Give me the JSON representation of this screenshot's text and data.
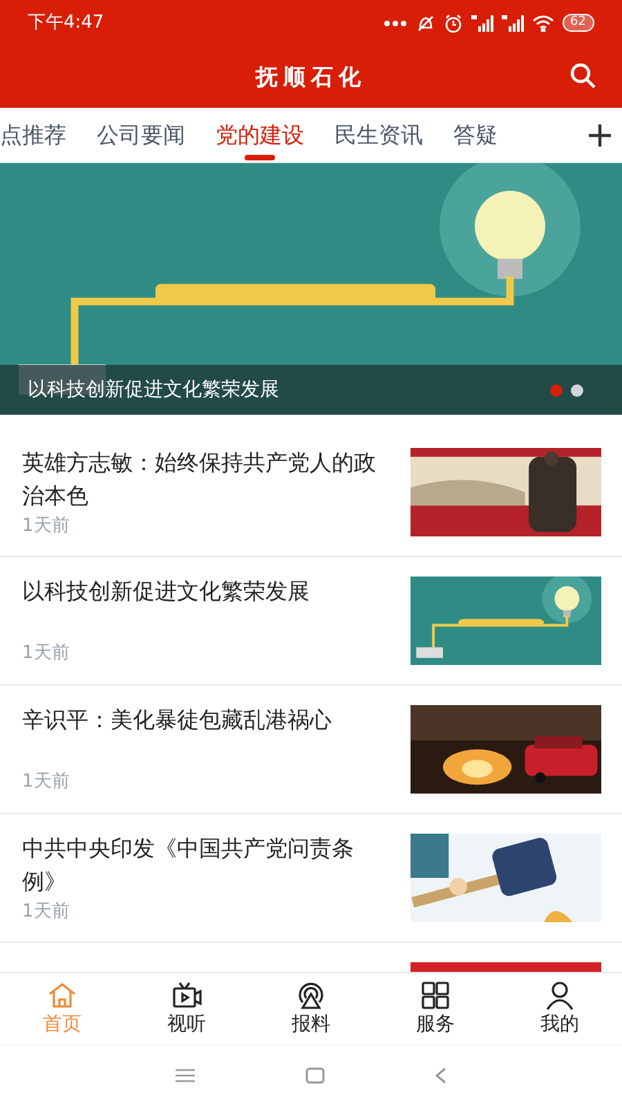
{
  "status_bar": {
    "time": "下午4:47",
    "battery": "62"
  },
  "header": {
    "title": "抚顺石化"
  },
  "tabs": [
    {
      "label": "点推荐",
      "selected": false
    },
    {
      "label": "公司要闻",
      "selected": false
    },
    {
      "label": "党的建设",
      "selected": true
    },
    {
      "label": "民生资讯",
      "selected": false
    },
    {
      "label": "答疑",
      "selected": false
    }
  ],
  "banner": {
    "kind": "picture",
    "caption": "以科技创新促进文化繁荣发展",
    "dots": [
      {
        "selected": true
      },
      {
        "selected": false
      }
    ]
  },
  "articles": [
    {
      "title": "英雄方志敏：始终保持共产党人的政治本色",
      "time": "1天前",
      "kind": "picture"
    },
    {
      "title": "以科技创新促进文化繁荣发展",
      "time": "1天前",
      "kind": "picture"
    },
    {
      "title": "辛识平：美化暴徒包藏乱港祸心",
      "time": "1天前",
      "kind": "picture"
    },
    {
      "title": "中共中央印发《中国共产党问责条例》",
      "time": "1天前",
      "kind": "picture"
    },
    {
      "kind": "picture"
    }
  ],
  "bottom_nav": [
    {
      "label": "首页",
      "kind": "home",
      "selected": true
    },
    {
      "label": "视听",
      "kind": "video",
      "selected": false
    },
    {
      "label": "报料",
      "kind": "broadcast",
      "selected": false
    },
    {
      "label": "服务",
      "kind": "grid",
      "selected": false
    },
    {
      "label": "我的",
      "kind": "person",
      "selected": false
    }
  ]
}
